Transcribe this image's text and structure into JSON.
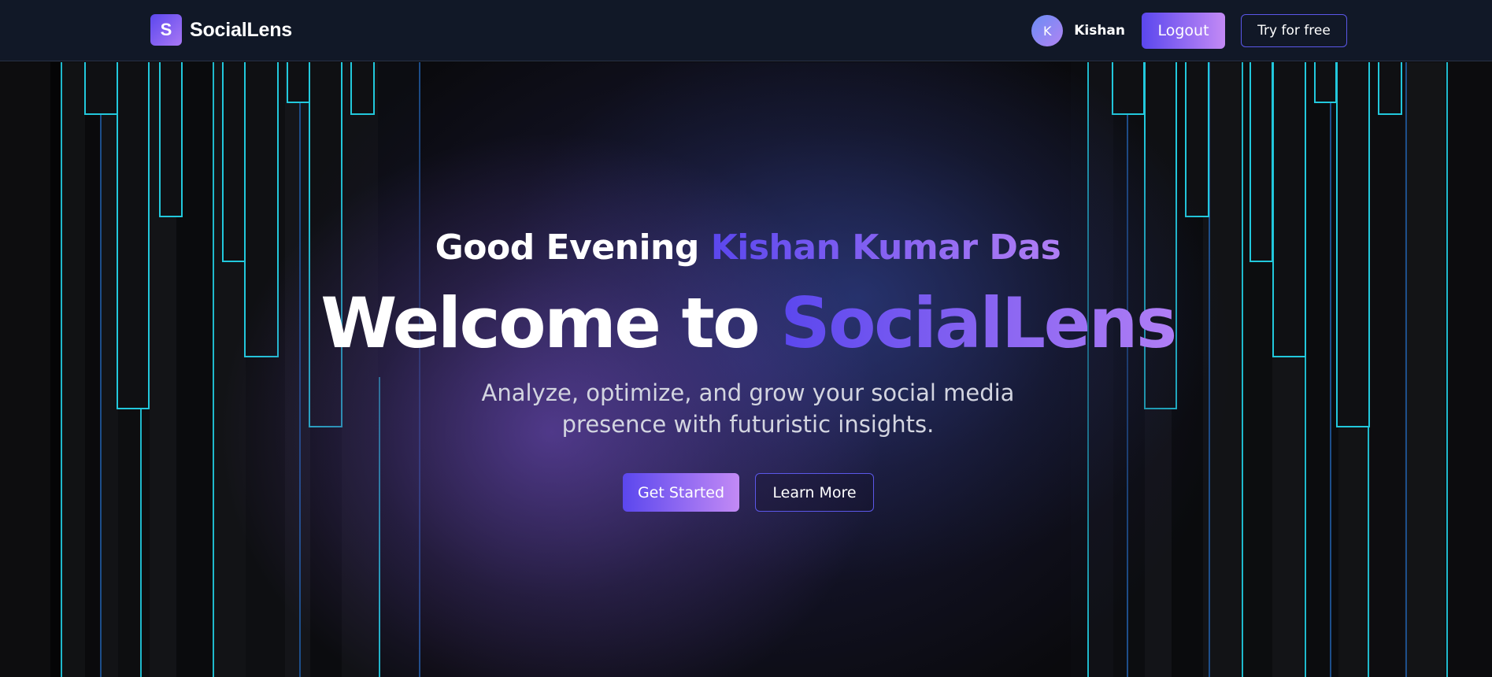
{
  "brand": {
    "logo_letter": "S",
    "name": "SocialLens"
  },
  "nav": {
    "avatar_initial": "K",
    "user_name": "Kishan",
    "logout_label": "Logout",
    "try_label": "Try for free"
  },
  "hero": {
    "greeting_prefix": "Good Evening ",
    "greeting_name": "Kishan Kumar Das",
    "headline_prefix": "Welcome to ",
    "headline_brand": "SocialLens",
    "subtitle": "Analyze, optimize, and grow your social media presence with futuristic insights.",
    "primary_cta": "Get Started",
    "secondary_cta": "Learn More"
  },
  "colors": {
    "accent_start": "#5b47ee",
    "accent_end": "#c38af5",
    "bar_cyan": "#22c8dc",
    "nav_bg": "#111827"
  }
}
